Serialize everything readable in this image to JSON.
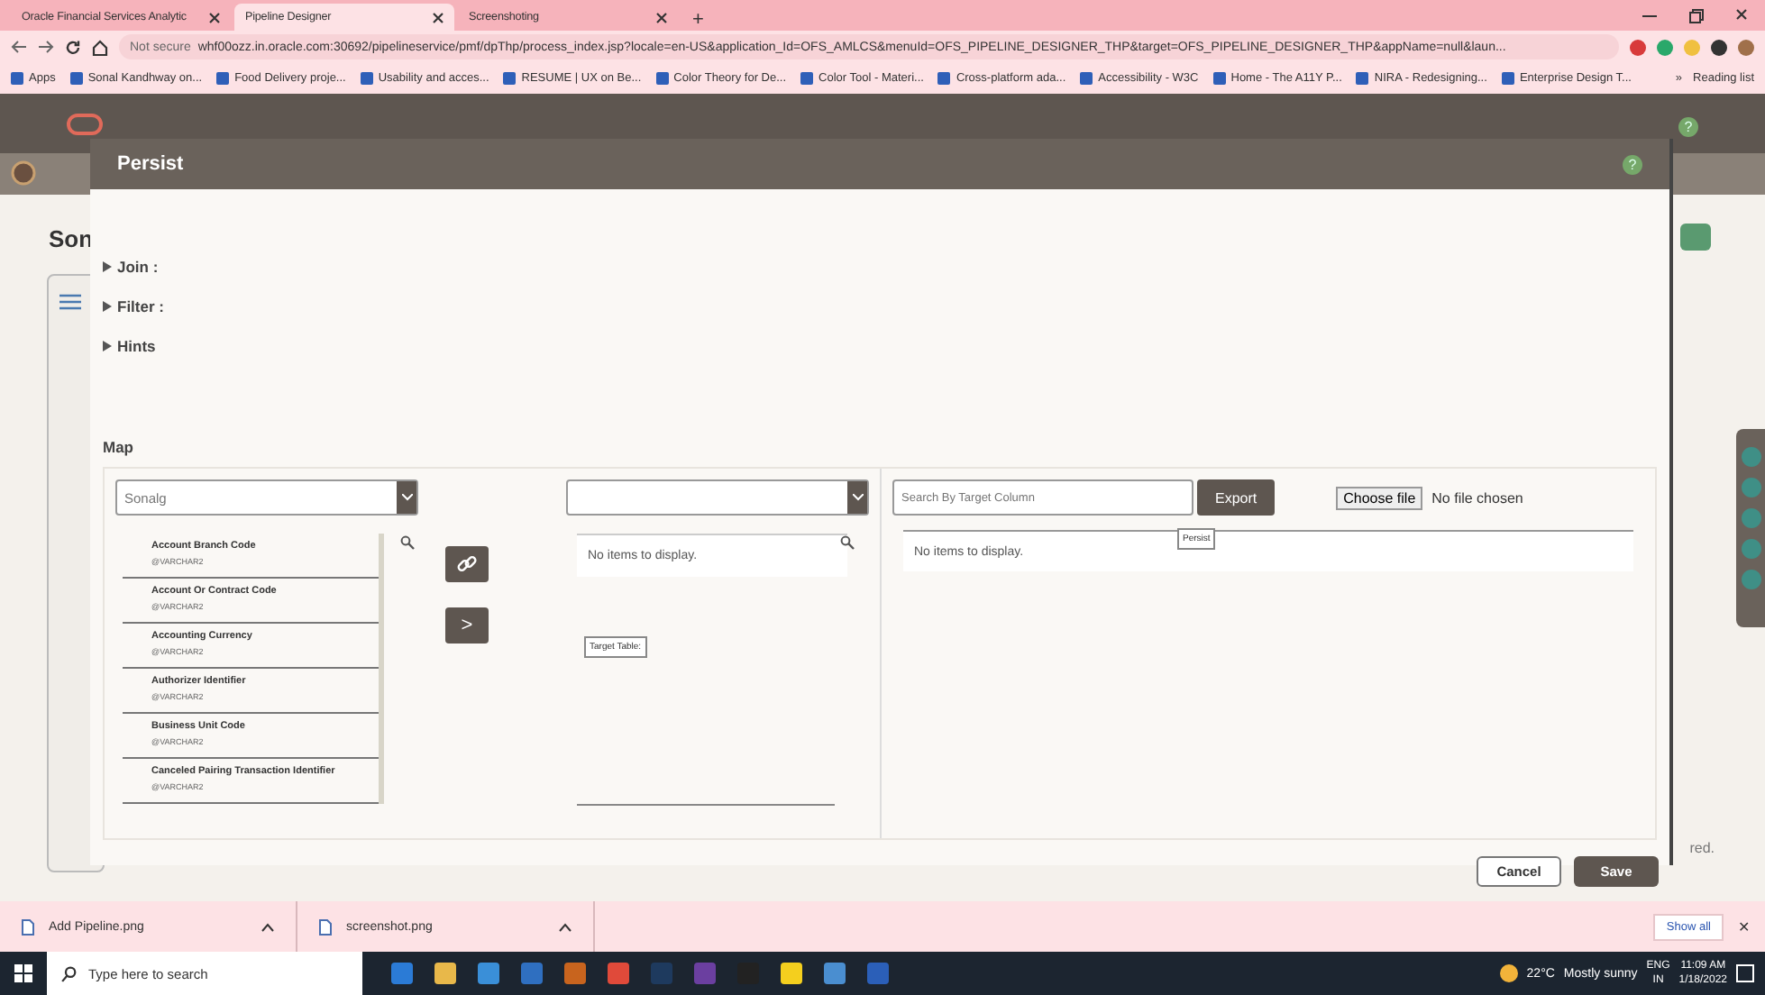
{
  "browser": {
    "tabs": [
      {
        "title": "Oracle Financial Services Analytic",
        "selected": false
      },
      {
        "title": "Pipeline Designer",
        "selected": true
      },
      {
        "title": "Screenshoting",
        "selected": false
      }
    ],
    "new_tab": "+",
    "address": {
      "security": "Not secure",
      "url": "whf00ozz.in.oracle.com:30692/pipelineservice/pmf/dpThp/process_index.jsp?locale=en-US&application_Id=OFS_AMLCS&menuId=OFS_PIPELINE_DESIGNER_THP&target=OFS_PIPELINE_DESIGNER_THP&appName=null&laun..."
    },
    "bookmarks": [
      "Apps",
      "Sonal Kandhway on...",
      "Food Delivery proje...",
      "Usability and acces...",
      "RESUME | UX on Be...",
      "Color Theory for De...",
      "Color Tool - Materi...",
      "Cross-platform ada...",
      "Accessibility - W3C",
      "Home - The A11Y P...",
      "NIRA - Redesigning...",
      "Enterprise Design T..."
    ],
    "more_bookmarks": "»",
    "reading_list": "Reading list"
  },
  "page": {
    "title": "Son",
    "help": "?",
    "footer_fragment": "red."
  },
  "dialog": {
    "title": "Persist",
    "help": "?",
    "sections": [
      {
        "label": "Join :",
        "expanded": false
      },
      {
        "label": "Filter :",
        "expanded": false
      },
      {
        "label": "Hints",
        "expanded": false
      }
    ],
    "map": {
      "title": "Map",
      "source": {
        "value": "Sonalg",
        "columns": [
          {
            "name": "Account Branch Code",
            "type": "@VARCHAR2"
          },
          {
            "name": "Account Or Contract Code",
            "type": "@VARCHAR2"
          },
          {
            "name": "Accounting Currency",
            "type": "@VARCHAR2"
          },
          {
            "name": "Authorizer Identifier",
            "type": "@VARCHAR2"
          },
          {
            "name": "Business Unit Code",
            "type": "@VARCHAR2"
          },
          {
            "name": "Canceled Pairing Transaction Identifier",
            "type": "@VARCHAR2"
          }
        ]
      },
      "move_button": ">",
      "target": {
        "empty": "No items to display.",
        "tooltip": "Target Table:"
      },
      "mapping": {
        "search_placeholder": "Search By Target Column",
        "export": "Export",
        "tooltip": "Persist",
        "choose_file": "Choose file",
        "file_status": "No file chosen",
        "empty": "No items to display."
      }
    },
    "buttons": [
      "Cancel",
      "Save"
    ]
  },
  "downloads": {
    "files": [
      "Add Pipeline.png",
      "screenshot.png"
    ],
    "show_all": "Show all",
    "close": "✕"
  },
  "taskbar": {
    "search_placeholder": "Type here to search",
    "weather": "22°C",
    "weather_text": "Mostly sunny",
    "lang": "ENG",
    "region": "IN",
    "time": "11:09 AM",
    "date": "1/18/2022"
  }
}
